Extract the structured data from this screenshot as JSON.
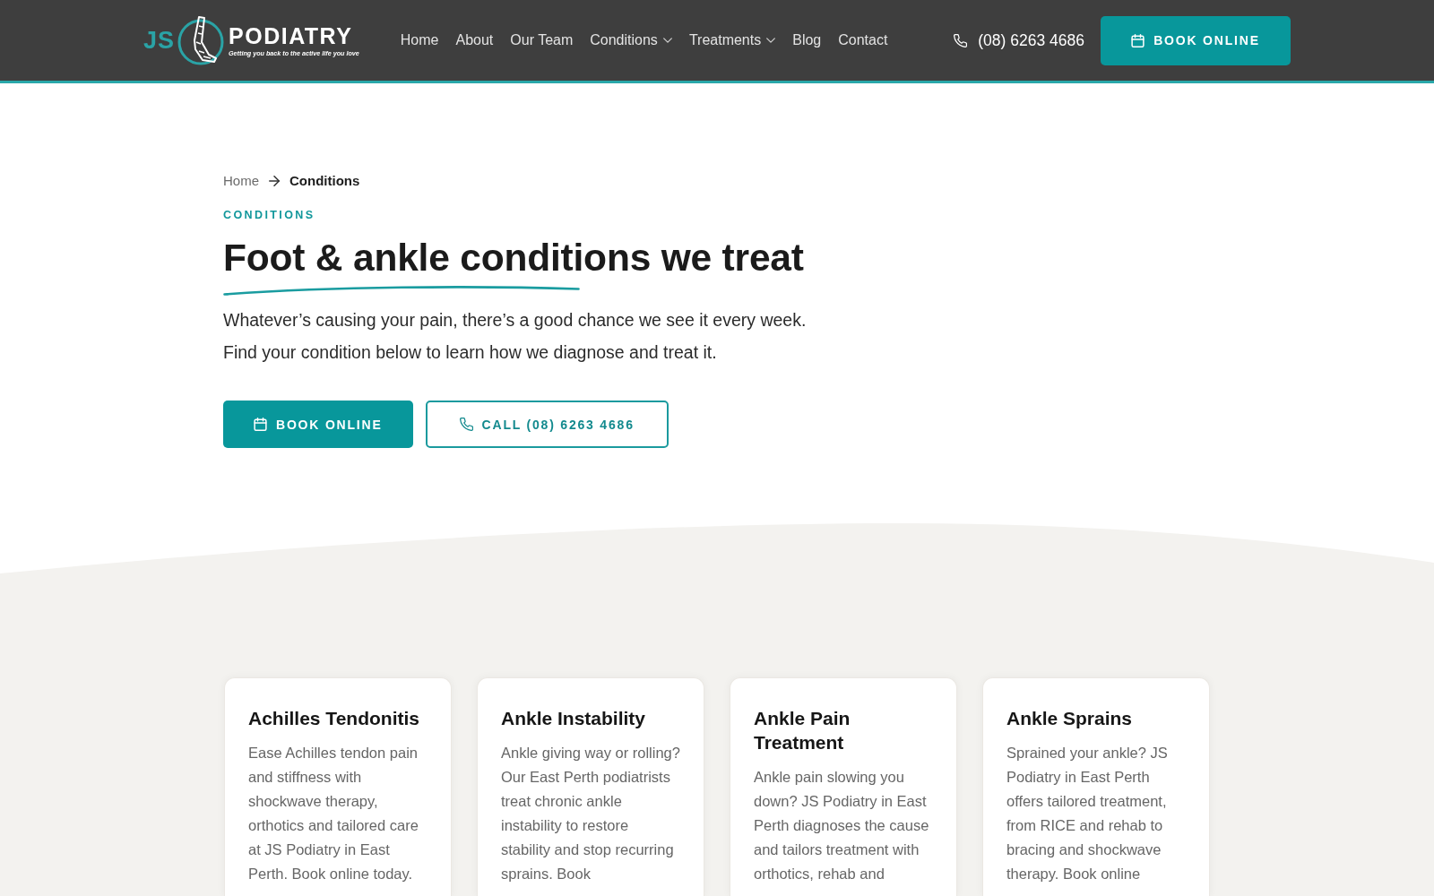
{
  "header": {
    "logo": {
      "initials": "JS",
      "name": "PODIATRY",
      "tagline": "Getting you back to the active life you love"
    },
    "nav": [
      {
        "label": "Home",
        "dropdown": false
      },
      {
        "label": "About",
        "dropdown": false
      },
      {
        "label": "Our Team",
        "dropdown": false
      },
      {
        "label": "Conditions",
        "dropdown": true
      },
      {
        "label": "Treatments",
        "dropdown": true
      },
      {
        "label": "Blog",
        "dropdown": false
      },
      {
        "label": "Contact",
        "dropdown": false
      }
    ],
    "phone": "(08) 6263 4686",
    "book_button": "BOOK ONLINE"
  },
  "hero": {
    "breadcrumb": [
      {
        "label": "Home",
        "current": false
      },
      {
        "label": "Conditions",
        "current": true
      }
    ],
    "eyebrow": "CONDITIONS",
    "title": "Foot & ankle conditions we treat",
    "intro": "Whatever’s causing your pain, there’s a good chance we see it every week. Find your condition below to learn how we diagnose and treat it.",
    "buttons": [
      {
        "kind": "primary",
        "label": "BOOK ONLINE"
      },
      {
        "kind": "outline",
        "label": "CALL (08) 6263 4686"
      }
    ]
  },
  "cards": [
    {
      "title": "Achilles Tendonitis",
      "text": "Ease Achilles tendon pain and stiffness with shockwave therapy, orthotics and tailored care at JS Podiatry in East Perth. Book online today."
    },
    {
      "title": "Ankle Instability",
      "text": "Ankle giving way or rolling? Our East Perth podiatrists treat chronic ankle instability to restore stability and stop recurring sprains. Book"
    },
    {
      "title": "Ankle Pain Treatment",
      "text": "Ankle pain slowing you down? JS Podiatry in East Perth diagnoses the cause and tailors treatment with orthotics, rehab and"
    },
    {
      "title": "Ankle Sprains",
      "text": "Sprained your ankle? JS Podiatry in East Perth offers tailored treatment, from RICE and rehab to bracing and shockwave therapy. Book online"
    }
  ]
}
